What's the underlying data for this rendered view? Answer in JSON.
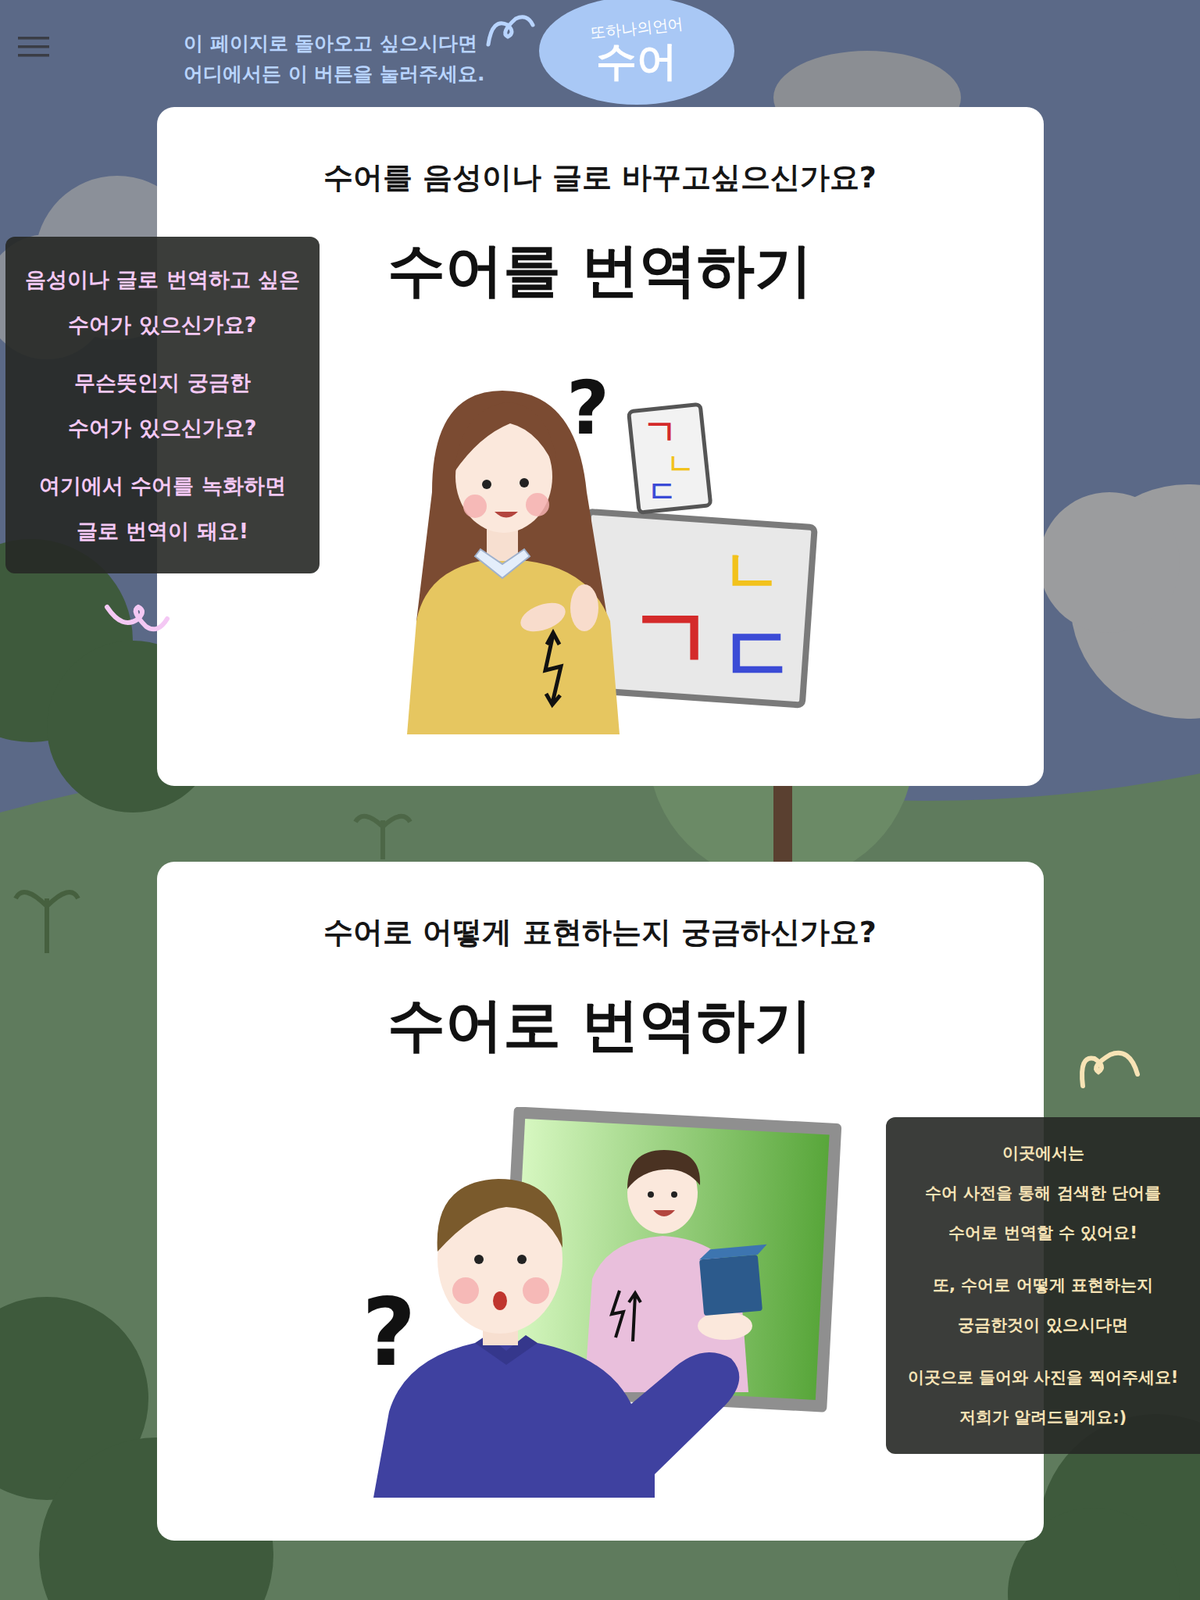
{
  "header": {
    "hint_lines": [
      "이 페이지로 돌아오고 싶으시다면",
      "어디에서든 이 버튼을 눌러주세요."
    ],
    "logo": {
      "tagline": "또하나의언어",
      "name": "수어"
    }
  },
  "cards": [
    {
      "subtitle": "수어를 음성이나 글로 바꾸고싶으신가요?",
      "title": "수어를 번역하기",
      "illustration": {
        "kind": "sign-to-text",
        "mark": "?",
        "letters": [
          {
            "text": "ㄱ",
            "color": "#d42a2a"
          },
          {
            "text": "ㄴ",
            "color": "#f2c21c"
          },
          {
            "text": "ㄷ",
            "color": "#3b4bd6"
          }
        ]
      }
    },
    {
      "subtitle": "수어로 어떻게 표현하는지 궁금하신가요?",
      "title": "수어로 번역하기",
      "illustration": {
        "kind": "text-to-sign",
        "mark": "?",
        "letters": []
      }
    }
  ],
  "tooltips": [
    {
      "paragraphs": [
        [
          "음성이나 글로 번역하고 싶은",
          "수어가 있으신가요?"
        ],
        [
          "무슨뜻인지 궁금한",
          "수어가 있으신가요?"
        ],
        [
          "여기에서 수어를 녹화하면",
          "글로 번역이 돼요!"
        ]
      ]
    },
    {
      "paragraphs": [
        [
          "이곳에서는",
          "수어 사전을 통해 검색한 단어를",
          "수어로 번역할 수 있어요!"
        ],
        [
          "또, 수어로 어떻게 표현하는지",
          "궁금한것이 있으시다면"
        ],
        [
          "이곳으로 들어와 사진을 찍어주세요!",
          "저희가 알려드릴게요:)"
        ]
      ]
    }
  ]
}
